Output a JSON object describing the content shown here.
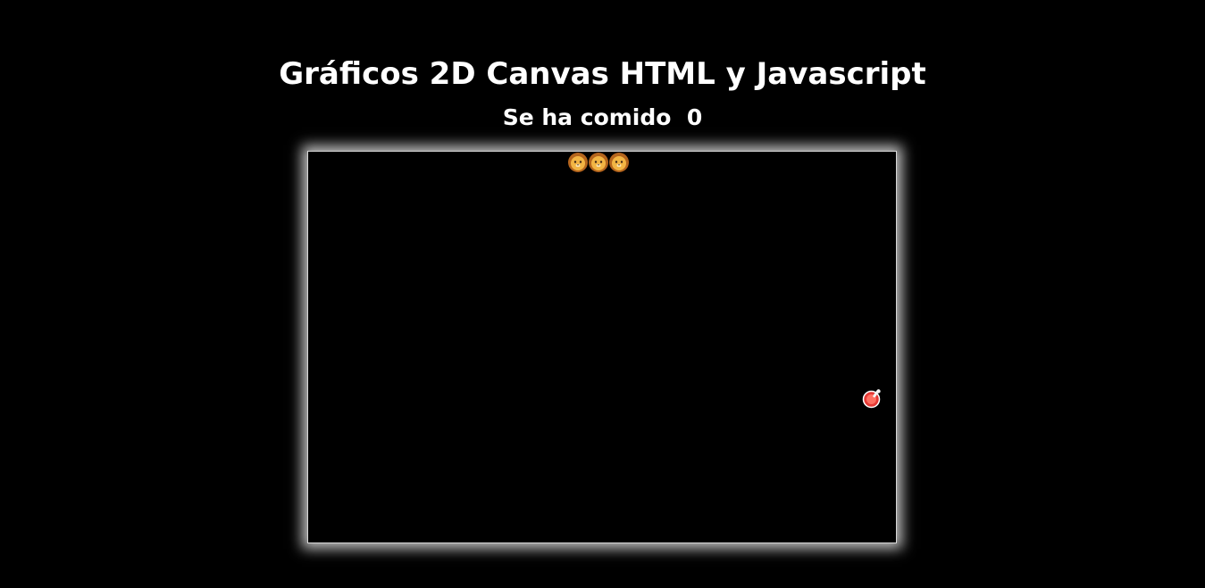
{
  "header": {
    "title": "Gráficos 2D Canvas HTML y Javascript",
    "score_label": "Se ha comido",
    "score_value": "0"
  },
  "game": {
    "snake_segments": [
      {
        "icon": "lion-face-icon"
      },
      {
        "icon": "lion-face-icon"
      },
      {
        "icon": "lion-face-icon"
      }
    ],
    "food": {
      "icon": "meat-icon"
    },
    "colors": {
      "background": "#000000",
      "text": "#ffffff",
      "board_glow": "#ffffff",
      "lion": "#e8a23a",
      "meat": "#e53935"
    }
  }
}
